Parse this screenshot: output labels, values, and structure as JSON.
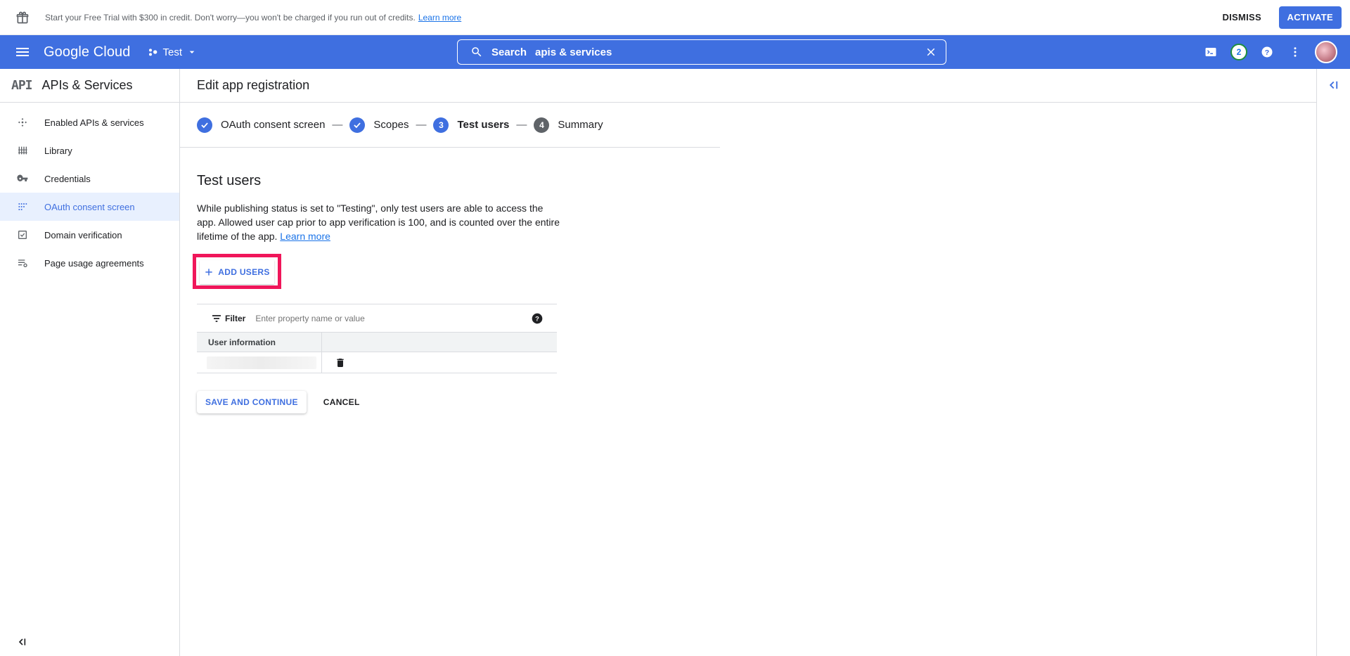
{
  "banner": {
    "message": "Start your Free Trial with $300 in credit. Don't worry—you won't be charged if you run out of credits.",
    "learn_more": "Learn more",
    "dismiss": "DISMISS",
    "activate": "ACTIVATE"
  },
  "appbar": {
    "logo": "Google Cloud",
    "project": "Test",
    "search_label": "Search",
    "search_value": "apis & services",
    "notification_count": "2"
  },
  "sidebar": {
    "title": "APIs & Services",
    "api_mark": "API",
    "items": [
      {
        "label": "Enabled APIs & services",
        "icon": "apis-icon"
      },
      {
        "label": "Library",
        "icon": "library-icon"
      },
      {
        "label": "Credentials",
        "icon": "key-icon"
      },
      {
        "label": "OAuth consent screen",
        "icon": "consent-icon"
      },
      {
        "label": "Domain verification",
        "icon": "checkbox-icon"
      },
      {
        "label": "Page usage agreements",
        "icon": "settings-list-icon"
      }
    ],
    "active_index": 3
  },
  "page": {
    "title": "Edit app registration",
    "steps": [
      {
        "label": "OAuth consent screen",
        "state": "done"
      },
      {
        "label": "Scopes",
        "state": "done"
      },
      {
        "label": "Test users",
        "state": "current",
        "number": "3"
      },
      {
        "label": "Summary",
        "state": "todo",
        "number": "4"
      }
    ],
    "section_title": "Test users",
    "description": "While publishing status is set to \"Testing\", only test users are able to access the app. Allowed user cap prior to app verification is 100, and is counted over the entire lifetime of the app.",
    "learn_more": "Learn more",
    "add_users": "ADD USERS",
    "filter_label": "Filter",
    "filter_placeholder": "Enter property name or value",
    "table_header": "User information",
    "save_continue": "SAVE AND CONTINUE",
    "cancel": "CANCEL"
  },
  "colors": {
    "accent": "#3f6fe0",
    "highlight_border": "#f0165a",
    "active_nav_bg": "#e8f0fe"
  }
}
